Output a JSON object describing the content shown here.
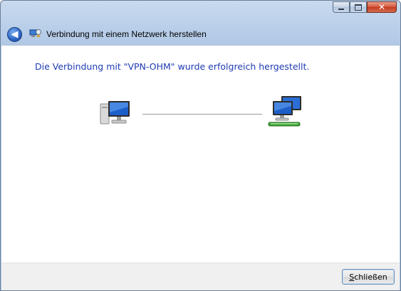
{
  "window": {
    "title": "Verbindung mit einem Netzwerk herstellen",
    "controls": [
      "minimize-icon",
      "maximize-icon",
      "close-icon"
    ]
  },
  "content": {
    "heading": "Die Verbindung mit \"VPN-OHM\" wurde erfolgreich hergestellt.",
    "left_icon": "computer-icon",
    "right_icon": "network-icon"
  },
  "footer": {
    "close_label_first": "S",
    "close_label_rest": "chließen"
  },
  "colors": {
    "heading": "#1e3bb3",
    "chrome": "#bcd1ea",
    "footer": "#f0f0f0"
  }
}
